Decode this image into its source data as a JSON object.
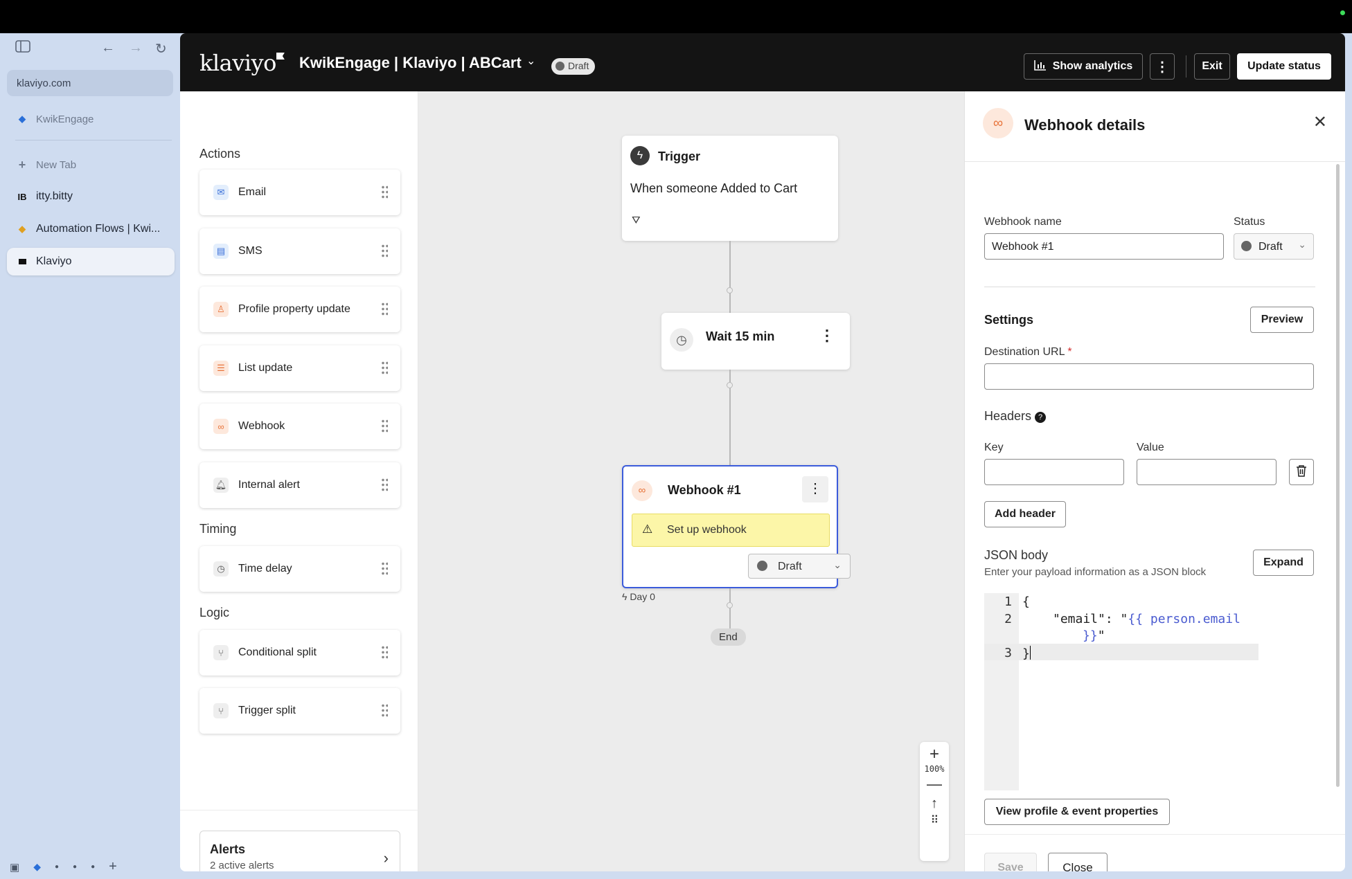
{
  "browser": {
    "url": "klaviyo.com",
    "tabs": [
      {
        "label": "KwikEngage",
        "active": false
      },
      {
        "label": "New Tab",
        "active": false
      },
      {
        "label": "itty.bitty",
        "active": false
      },
      {
        "label": "Automation Flows | Kwi...",
        "active": false
      },
      {
        "label": "Klaviyo",
        "active": true
      }
    ]
  },
  "header": {
    "logo": "klaviyo",
    "flow_title": "KwikEngage | Klaviyo | ABCart",
    "status_badge": "Draft",
    "show_analytics": "Show analytics",
    "exit": "Exit",
    "update_status": "Update status"
  },
  "actions_panel": {
    "actions_heading": "Actions",
    "actions": [
      {
        "label": "Email",
        "icon": "mail-icon"
      },
      {
        "label": "SMS",
        "icon": "sms-icon"
      },
      {
        "label": "Profile property update",
        "icon": "profile-icon"
      },
      {
        "label": "List update",
        "icon": "list-icon"
      },
      {
        "label": "Webhook",
        "icon": "webhook-icon"
      },
      {
        "label": "Internal alert",
        "icon": "bell-icon"
      }
    ],
    "timing_heading": "Timing",
    "timing": [
      {
        "label": "Time delay",
        "icon": "clock-icon"
      }
    ],
    "logic_heading": "Logic",
    "logic": [
      {
        "label": "Conditional split",
        "icon": "split-icon"
      },
      {
        "label": "Trigger split",
        "icon": "trigger-split-icon"
      }
    ],
    "alerts": {
      "title": "Alerts",
      "subtitle": "2 active alerts"
    }
  },
  "canvas": {
    "trigger": {
      "title": "Trigger",
      "description": "When someone Added to Cart"
    },
    "wait": {
      "label": "Wait 15 min"
    },
    "webhook_node": {
      "title": "Webhook #1",
      "warning": "Set up webhook",
      "status": "Draft",
      "day": "Day 0"
    },
    "end": "End",
    "zoom_level": "100%"
  },
  "details": {
    "title": "Webhook details",
    "webhook_name_label": "Webhook name",
    "webhook_name_value": "Webhook #1",
    "status_label": "Status",
    "status_value": "Draft",
    "settings_heading": "Settings",
    "preview_button": "Preview",
    "destination_url_label": "Destination URL",
    "required_mark": "*",
    "destination_url_value": "",
    "headers_label": "Headers",
    "key_label": "Key",
    "value_label": "Value",
    "add_header_button": "Add header",
    "json_body_label": "JSON body",
    "json_body_hint": "Enter your payload information as a JSON block",
    "expand_button": "Expand",
    "code_lines": [
      "1",
      "2",
      "3"
    ],
    "code_open": "{",
    "code_key": "\"email\": \"",
    "code_value1": "{{ person.email",
    "code_value2": "}}",
    "code_quote": "\"",
    "code_close": "}",
    "view_properties_button": "View profile & event properties",
    "save_button": "Save",
    "close_button": "Close"
  },
  "colors": {
    "accent_orange": "#e8743b",
    "warning_bg": "#fcf6a8",
    "node_border": "#3b5bdb"
  }
}
